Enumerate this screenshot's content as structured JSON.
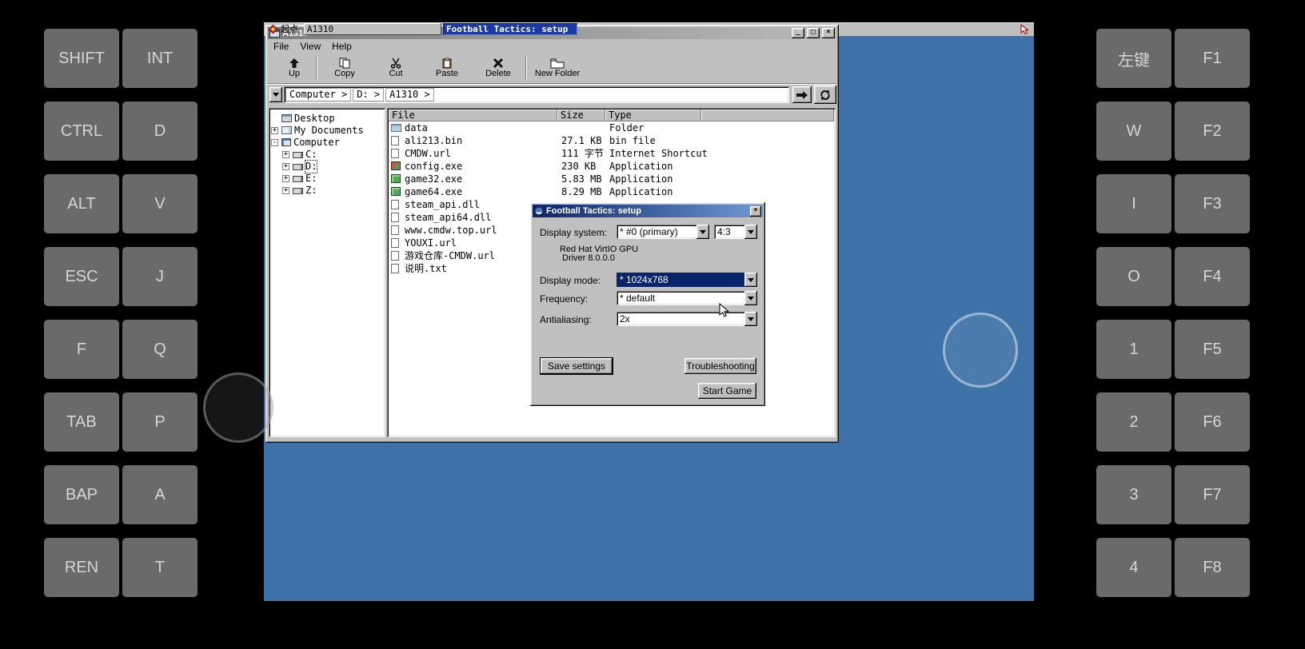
{
  "colors": {
    "desktop_blue": "#3f72a8",
    "window_gray": "#c0c0c0",
    "selection_blue": "#0a246a",
    "taskbar_active_blue": "#1a3aa8",
    "keypad_gray": "#6a6a6a"
  },
  "icons": {
    "minimize": "_",
    "maximize": "□",
    "close": "×"
  },
  "left_keypad": {
    "keys": [
      "SHIFT",
      "INT",
      "CTRL",
      "D",
      "ALT",
      "V",
      "ESC",
      "J",
      "F",
      "Q",
      "TAB",
      "P",
      "BAP",
      "A",
      "REN",
      "T"
    ]
  },
  "right_keypad": {
    "keys": [
      "左键",
      "F1",
      "W",
      "F2",
      "I",
      "F3",
      "O",
      "F4",
      "1",
      "F5",
      "2",
      "F6",
      "3",
      "F7",
      "4",
      "F8"
    ]
  },
  "explorer": {
    "title": "A1310",
    "menu": {
      "file": "File",
      "view": "View",
      "help": "Help"
    },
    "toolbar": {
      "up": "Up",
      "copy": "Copy",
      "cut": "Cut",
      "paste": "Paste",
      "delete": "Delete",
      "new_folder": "New Folder"
    },
    "address": {
      "crumb1": "Computer >",
      "crumb2": "D: >",
      "crumb3": "A1310 >"
    },
    "tree": {
      "items": [
        {
          "label": "Desktop",
          "expand": ""
        },
        {
          "label": "My Documents",
          "expand": "+"
        },
        {
          "label": "Computer",
          "expand": "-"
        },
        {
          "label": "C:",
          "expand": "+"
        },
        {
          "label": "D:",
          "expand": "+"
        },
        {
          "label": "E:",
          "expand": "+"
        },
        {
          "label": "Z:",
          "expand": "+"
        }
      ]
    },
    "filelist": {
      "headers": {
        "file": "File",
        "size": "Size",
        "type": "Type"
      },
      "rows": [
        {
          "name": "data",
          "size": "",
          "type": "Folder"
        },
        {
          "name": "ali213.bin",
          "size": "27.1 KB",
          "type": "bin file"
        },
        {
          "name": "CMDW.url",
          "size": "111 字节",
          "type": "Internet Shortcut"
        },
        {
          "name": "config.exe",
          "size": "230 KB",
          "type": "Application"
        },
        {
          "name": "game32.exe",
          "size": "5.83 MB",
          "type": "Application"
        },
        {
          "name": "game64.exe",
          "size": "8.29 MB",
          "type": "Application"
        },
        {
          "name": "steam_api.dll",
          "size": "",
          "type": ""
        },
        {
          "name": "steam_api64.dll",
          "size": "",
          "type": ""
        },
        {
          "name": "www.cmdw.top.url",
          "size": "",
          "type": ""
        },
        {
          "name": "YOUXI.url",
          "size": "",
          "type": ""
        },
        {
          "name": "游戏仓库-CMDW.url",
          "size": "",
          "type": ""
        },
        {
          "name": "说明.txt",
          "size": "",
          "type": ""
        }
      ]
    }
  },
  "dialog": {
    "title": "Football Tactics: setup",
    "display_system_label": "Display system:",
    "display_system_value": "* #0 (primary)",
    "aspect_value": "4:3",
    "gpu_name": "Red Hat VirtIO GPU",
    "gpu_driver": "Driver 8.0.0.0",
    "display_mode_label": "Display mode:",
    "display_mode_value": "* 1024x768",
    "frequency_label": "Frequency:",
    "frequency_value": "* default",
    "antialiasing_label": "Antialiasing:",
    "antialiasing_value": "2x",
    "save_button": "Save settings",
    "troubleshooting_button": "Troubleshooting",
    "start_button": "Start Game"
  },
  "taskbar": {
    "start_label": "起点",
    "task1": "A1310",
    "task2": "Football Tactics: setup"
  }
}
